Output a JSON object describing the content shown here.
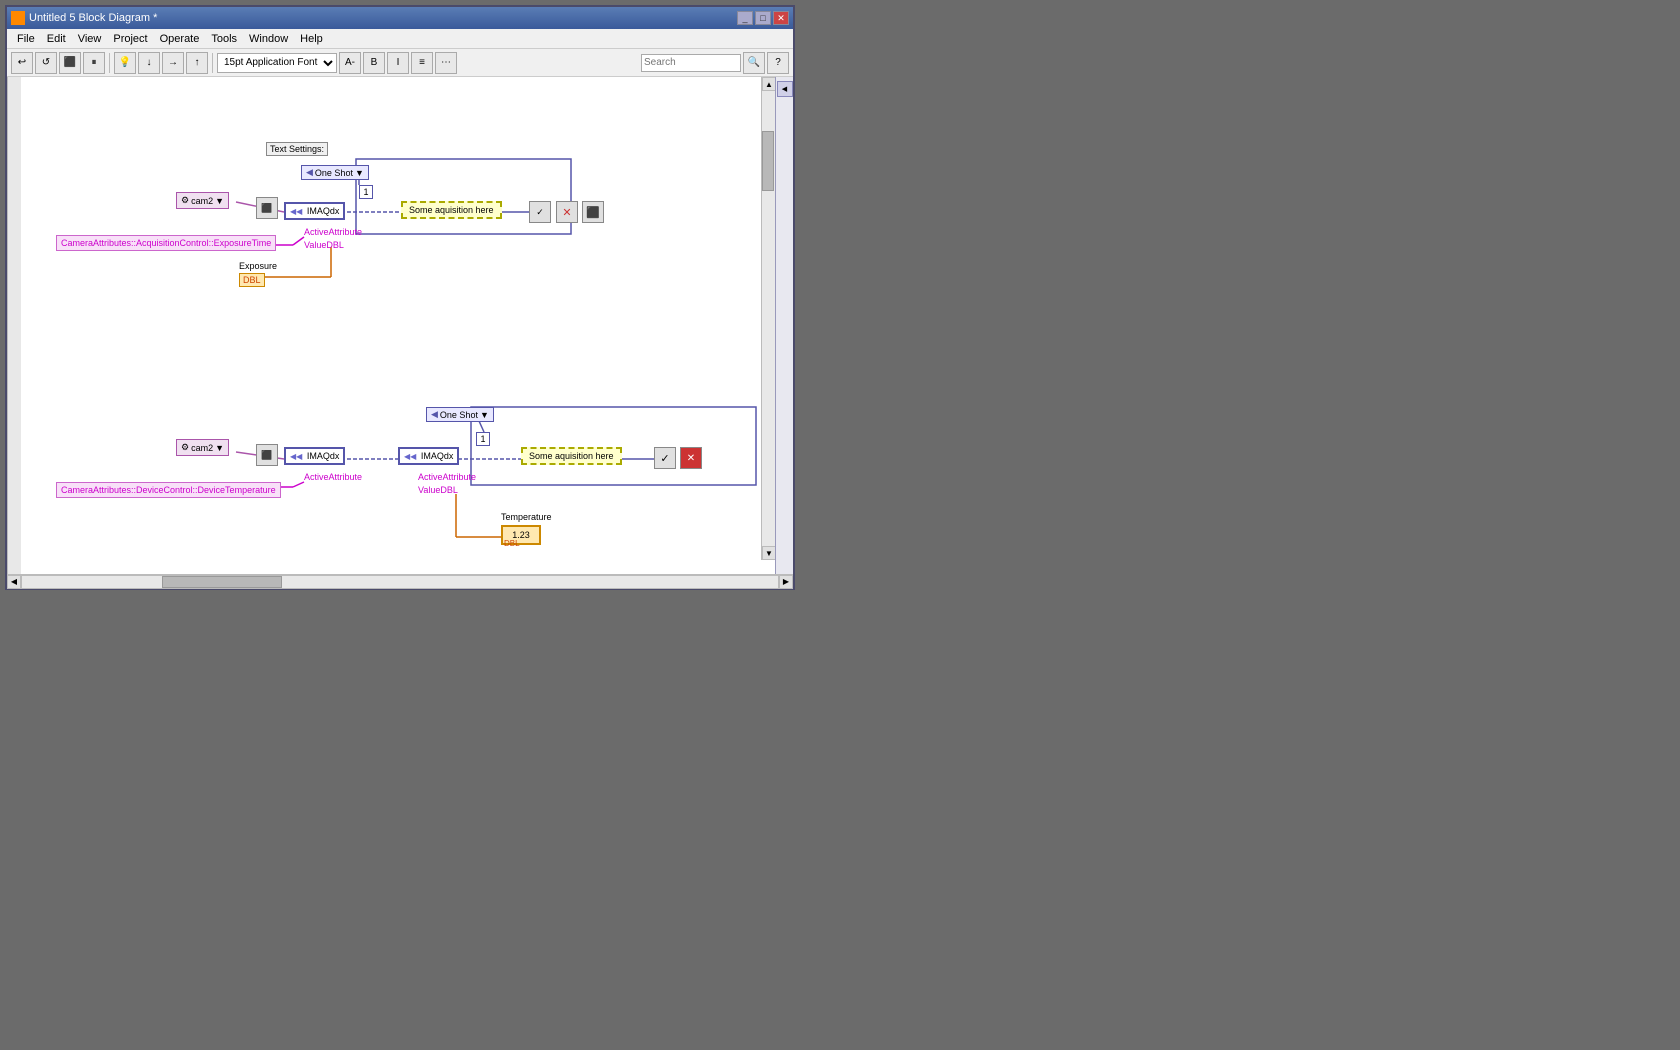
{
  "window": {
    "title": "Untitled 5 Block Diagram *",
    "title_icon": "labview-icon"
  },
  "menu": {
    "items": [
      "File",
      "Edit",
      "View",
      "Project",
      "Operate",
      "Tools",
      "Window",
      "Help"
    ]
  },
  "toolbar": {
    "font": "15pt Application Font",
    "search_placeholder": "Search"
  },
  "diagram": {
    "top_section": {
      "text_settings": "Text Settings:",
      "one_shot": "One Shot",
      "cam2": "cam2",
      "imaq_label": "IMAQdx",
      "acquisition": "Some aquisition here",
      "cam_attribute": "CameraAttributes::AcquisitionControl::ExposureTime",
      "active_attribute": "ActiveAttribute",
      "value_dbl": "ValueDBL",
      "exposure": "Exposure",
      "dbl": "DBL",
      "iteration_num": "1"
    },
    "bottom_section": {
      "one_shot": "One Shot",
      "cam2": "cam2",
      "imaq_left": "IMAQdx",
      "imaq_right": "IMAQdx",
      "acquisition": "Some aquisition here",
      "cam_attribute": "CameraAttributes::DeviceControl::DeviceTemperature",
      "active_attribute_l": "ActiveAttribute",
      "active_attribute_r": "ActiveAttribute",
      "value_dbl": "ValueDBL",
      "temperature": "Temperature",
      "temp_value": "1.23",
      "dbl": "DBL",
      "iteration_num": "1"
    }
  }
}
